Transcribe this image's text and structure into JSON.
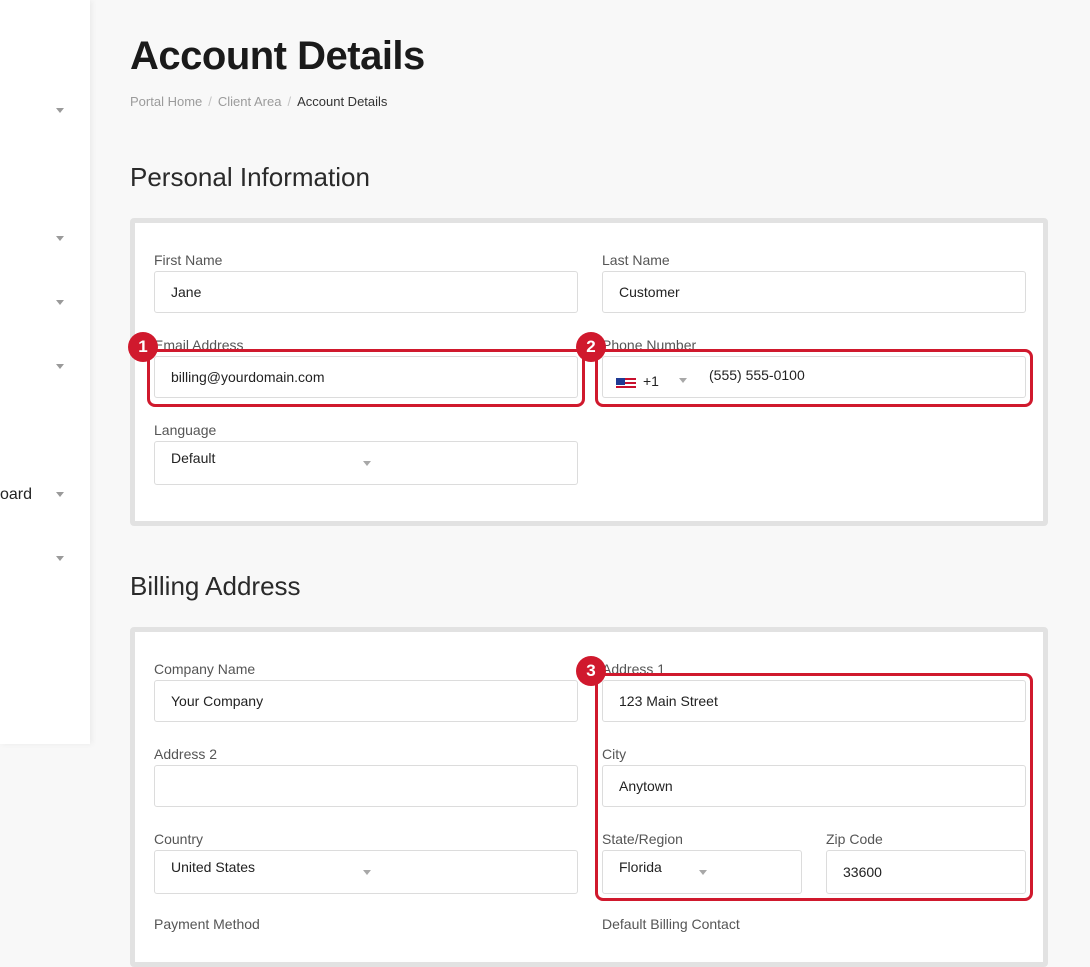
{
  "page": {
    "title": "Account Details",
    "breadcrumb": [
      "Portal Home",
      "Client Area",
      "Account Details"
    ]
  },
  "sidebar": {
    "partial_text": "oard"
  },
  "personal": {
    "title": "Personal Information",
    "first_name": {
      "label": "First Name",
      "value": "Jane"
    },
    "last_name": {
      "label": "Last Name",
      "value": "Customer"
    },
    "email": {
      "label": "Email Address",
      "value": "billing@yourdomain.com"
    },
    "phone": {
      "label": "Phone Number",
      "country_code": "+1",
      "value": "(555) 555-0100",
      "flag_icon": "us-flag-icon"
    },
    "language": {
      "label": "Language",
      "value": "Default"
    }
  },
  "billing": {
    "title": "Billing Address",
    "company": {
      "label": "Company Name",
      "value": "Your Company"
    },
    "address1": {
      "label": "Address 1",
      "value": "123 Main Street"
    },
    "address2": {
      "label": "Address 2",
      "value": ""
    },
    "city": {
      "label": "City",
      "value": "Anytown"
    },
    "country": {
      "label": "Country",
      "value": "United States"
    },
    "state": {
      "label": "State/Region",
      "value": "Florida"
    },
    "zip": {
      "label": "Zip Code",
      "value": "33600"
    },
    "payment_method": {
      "label": "Payment Method"
    },
    "billing_contact": {
      "label": "Default Billing Contact"
    }
  },
  "annotations": [
    "1",
    "2",
    "3"
  ],
  "colors": {
    "highlight": "#d0192d",
    "card_border": "#e2e2e2",
    "background": "#f8f8f8"
  }
}
